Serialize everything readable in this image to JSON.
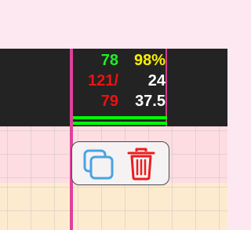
{
  "stats": {
    "value_green": "78",
    "value_percent": "98%",
    "value_red_top": "121/",
    "value_white_mid": "24",
    "value_red_bottom": "79",
    "value_white_bottom": "37.5"
  },
  "colors": {
    "green": "#22ee22",
    "yellow": "#ffee00",
    "red": "#ee1111",
    "white": "#ffffff",
    "dark_band": "#232323",
    "accent_line": "#e0409a",
    "duplicate_icon": "#4aa3e0",
    "delete_icon": "#ee1c1c"
  },
  "popup": {
    "duplicate_icon": "duplicate-icon",
    "delete_icon": "trash-icon"
  }
}
